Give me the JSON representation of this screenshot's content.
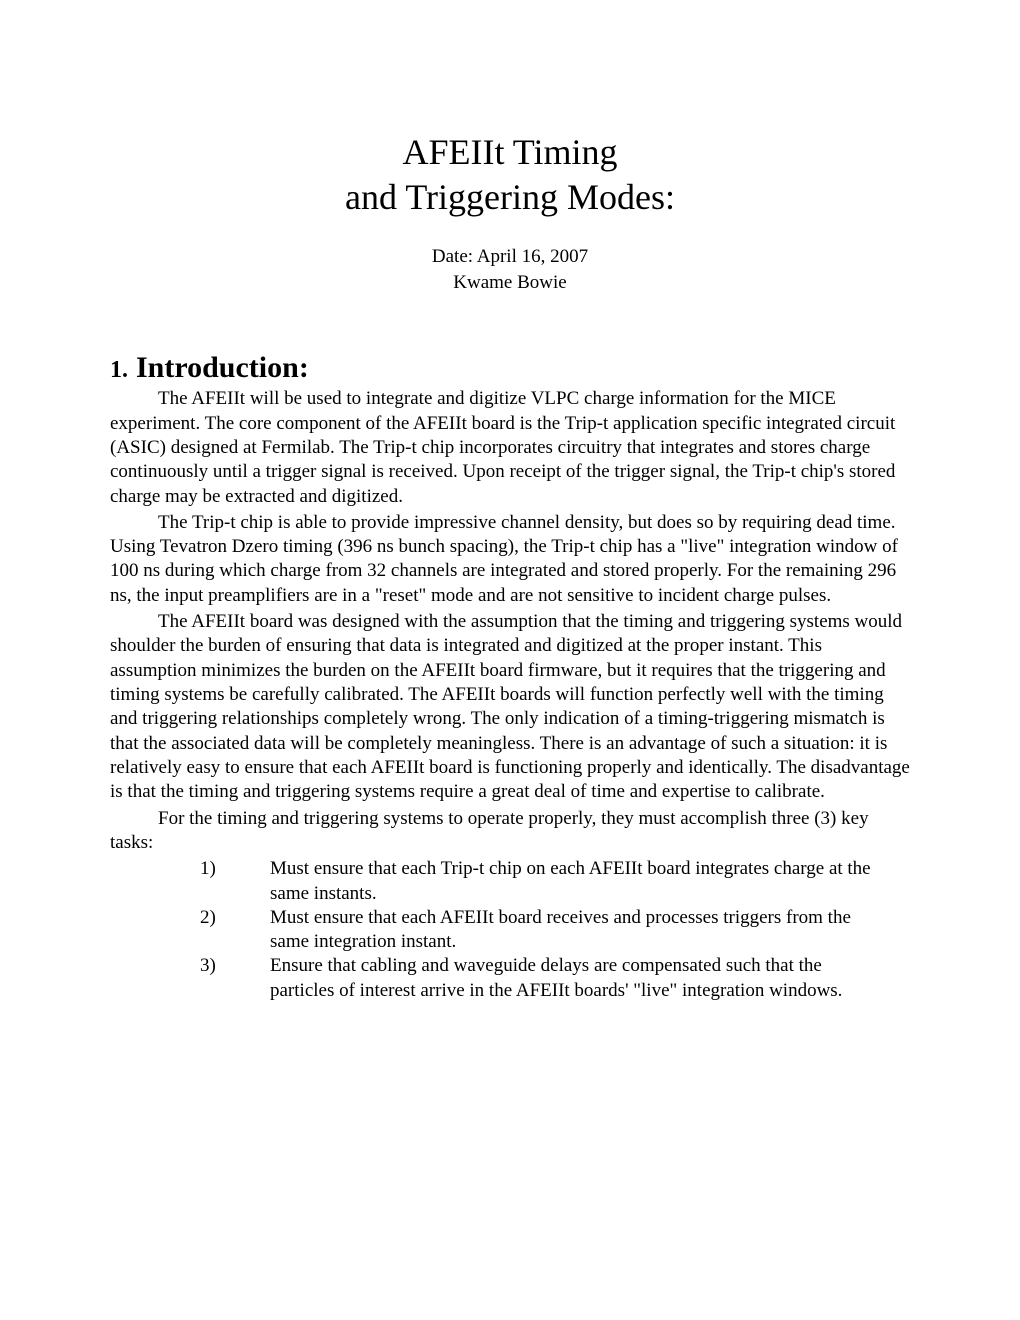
{
  "title": {
    "line1": "AFEIIt Timing",
    "line2": "and Triggering Modes:"
  },
  "meta": {
    "date": "Date: April 16, 2007",
    "author": "Kwame Bowie"
  },
  "section": {
    "number": "1.",
    "heading": "Introduction:",
    "para1": "The AFEIIt will be used to integrate and digitize VLPC charge information for the MICE experiment. The core component of the AFEIIt board is the Trip-t application specific integrated circuit (ASIC) designed at Fermilab. The Trip-t chip incorporates circuitry that integrates and stores charge continuously until a trigger signal is received. Upon receipt of the trigger signal, the Trip-t chip's stored charge may be extracted and digitized.",
    "para2": "The Trip-t chip is able to provide impressive channel density, but does so by requiring dead time. Using Tevatron Dzero timing (396 ns bunch spacing), the Trip-t chip has a \"live\" integration window of 100 ns during which charge from 32 channels are integrated and stored properly. For the remaining 296 ns, the input preamplifiers are in a \"reset\" mode and are not sensitive to incident charge pulses.",
    "para3": "The AFEIIt board was designed with the assumption that the timing and triggering systems would shoulder the burden of ensuring that data is integrated and digitized at the proper instant. This assumption minimizes the burden on the AFEIIt board firmware, but it requires that the triggering and timing systems be carefully calibrated. The AFEIIt boards will function perfectly well with the timing and triggering relationships completely wrong. The only indication of a timing-triggering mismatch is that the associated data will be completely meaningless. There is an advantage of such a situation: it is relatively easy to ensure that each AFEIIt board is functioning properly and identically. The disadvantage is that the timing and triggering systems require a great deal of time and expertise to calibrate.",
    "tasks_intro": "For the timing and triggering systems to operate properly, they must accomplish three (3) key tasks:",
    "tasks": [
      {
        "num": "1)",
        "text": "Must ensure that each Trip-t chip on each AFEIIt board integrates charge at the same instants."
      },
      {
        "num": "2)",
        "text": "Must ensure that each AFEIIt board receives and processes triggers from the same integration instant."
      },
      {
        "num": "3)",
        "text": "Ensure that cabling and waveguide delays are compensated such that the particles of interest arrive in the AFEIIt boards'  \"live\" integration windows."
      }
    ]
  }
}
